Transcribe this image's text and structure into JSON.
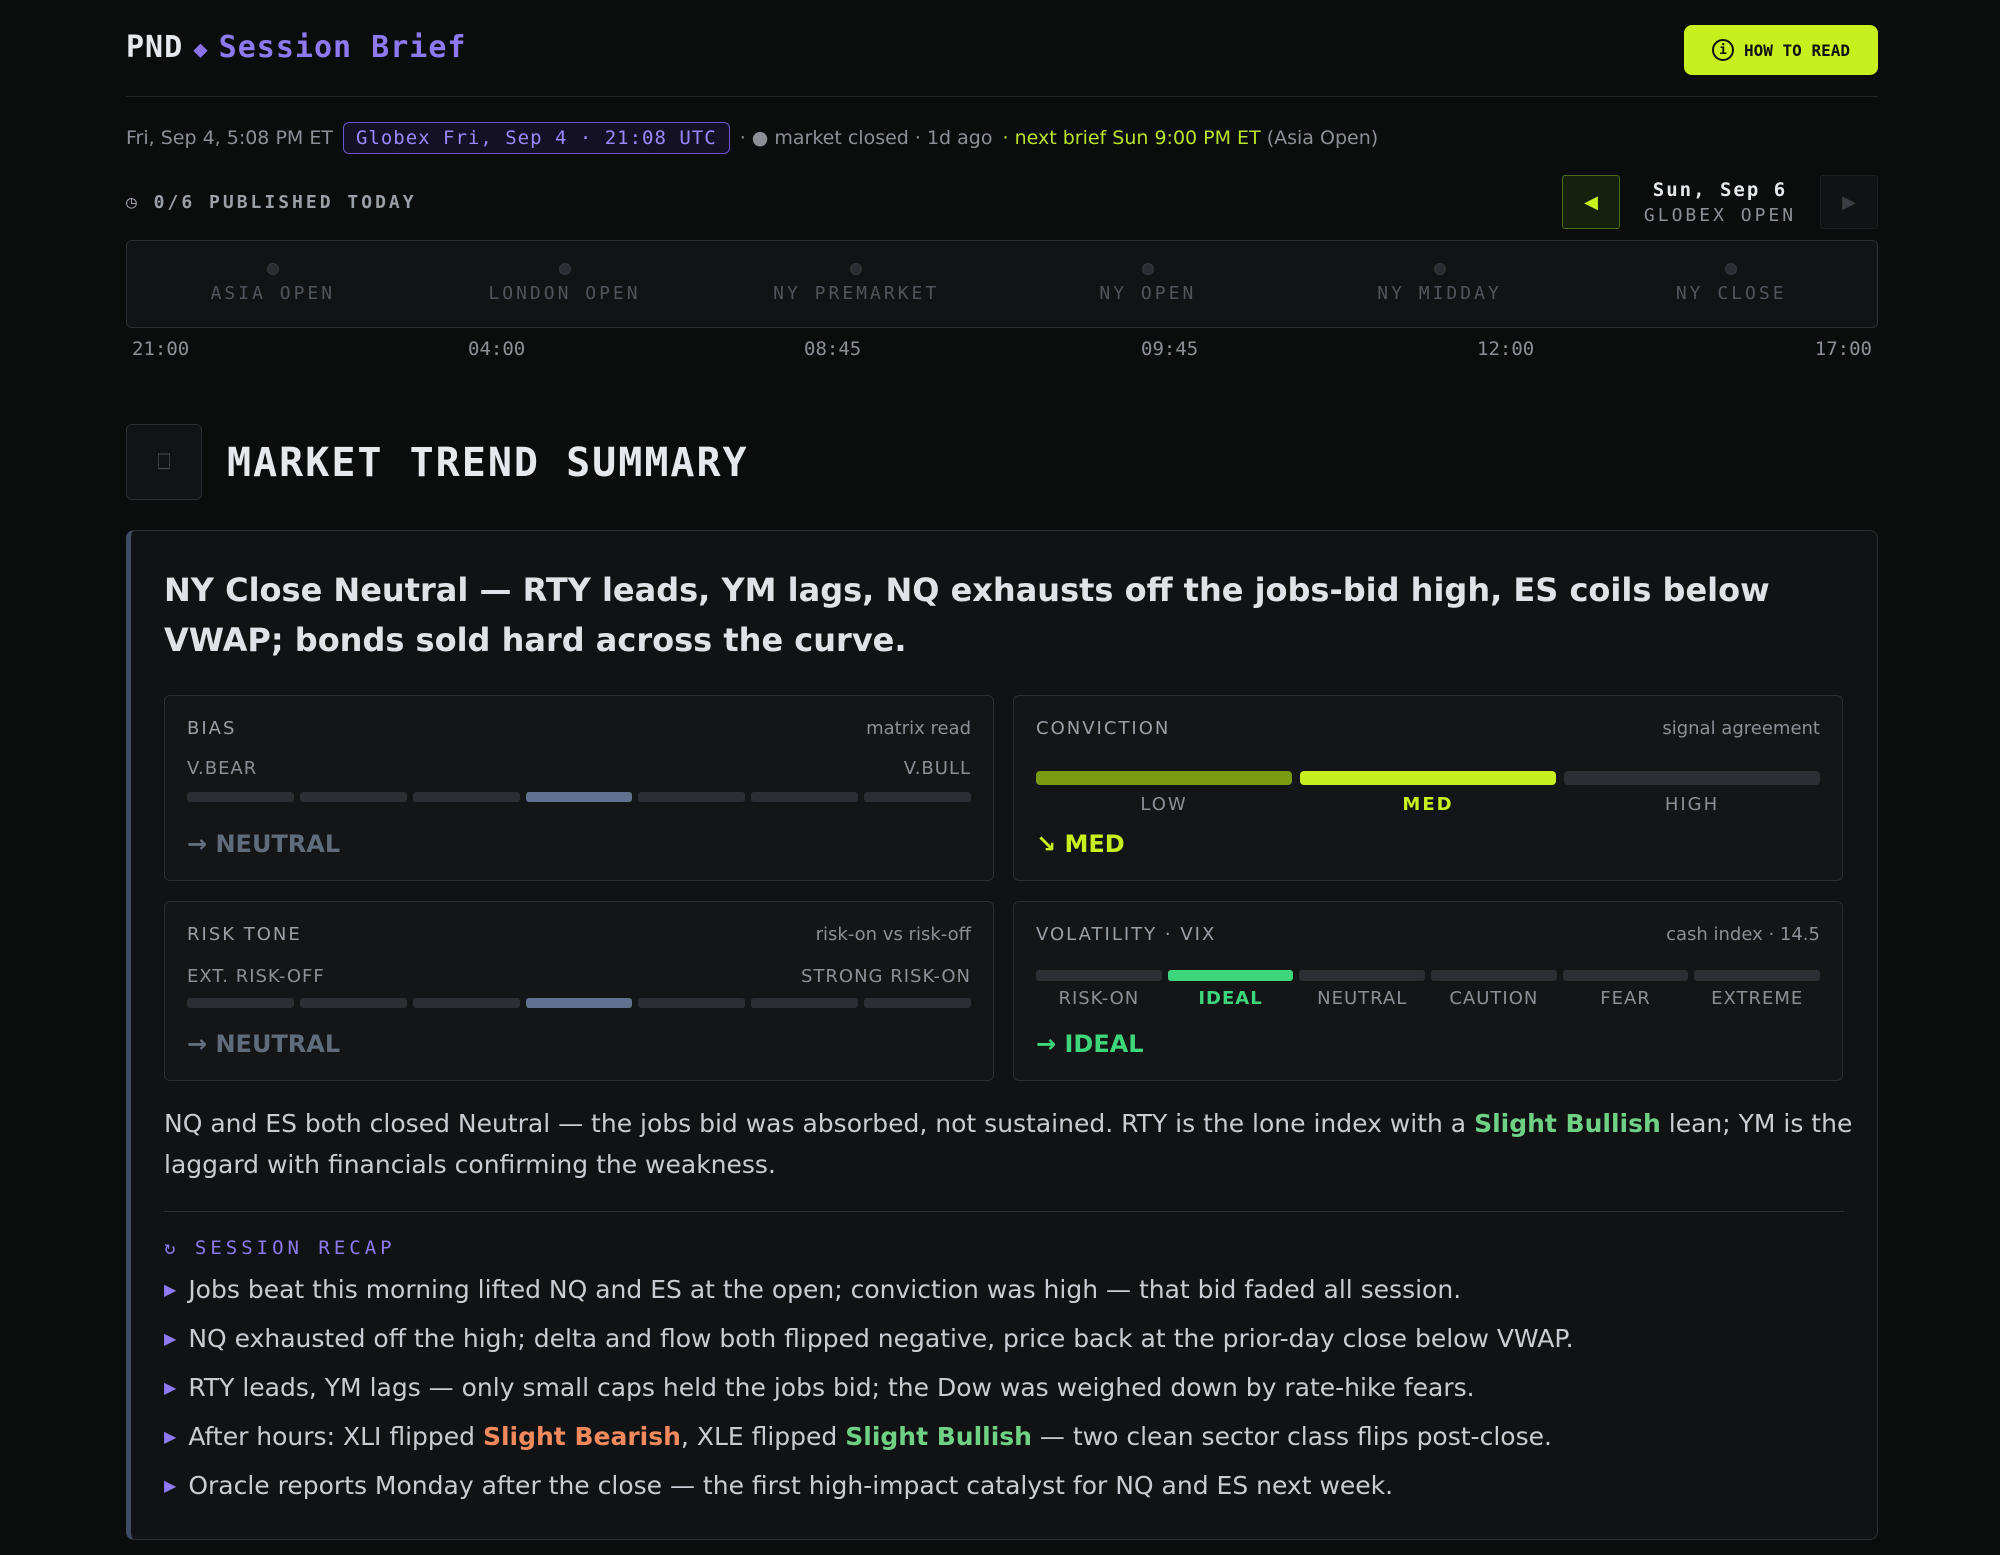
{
  "header": {
    "brand": "PND",
    "separator": "◆",
    "title": "Session Brief",
    "how_to_read": "HOW TO READ"
  },
  "meta": {
    "local_time": "Fri, Sep 4, 5:08 PM ET",
    "globex_pill": "Globex Fri, Sep 4 · 21:08 UTC",
    "status": "· ● market closed · 1d ago",
    "next_brief": "· next brief Sun 9:00 PM ET",
    "next_brief_session": "(Asia Open)"
  },
  "published": "◷ 0/6 PUBLISHED TODAY",
  "nav": {
    "prev": "◀",
    "next": "▶",
    "date": "Sun, Sep 6",
    "session": "GLOBEX OPEN"
  },
  "timeline": {
    "sessions": [
      "ASIA OPEN",
      "LONDON OPEN",
      "NY PREMARKET",
      "NY OPEN",
      "NY MIDDAY",
      "NY CLOSE"
    ],
    "times": [
      "21:00",
      "04:00",
      "08:45",
      "09:45",
      "12:00",
      "17:00"
    ]
  },
  "section": {
    "icon": "⎕",
    "title": "MARKET TREND SUMMARY"
  },
  "card": {
    "headline": "NY Close Neutral — RTY leads, YM lags, NQ exhausts off the jobs-bid high, ES coils below VWAP; bonds sold hard across the curve.",
    "bias": {
      "label": "BIAS",
      "note": "matrix read",
      "left": "V.BEAR",
      "right": "V.BULL",
      "segments": 7,
      "active_index": 3,
      "arrow": "→",
      "value": "NEUTRAL"
    },
    "conviction": {
      "label": "CONVICTION",
      "note": "signal agreement",
      "levels": [
        "LOW",
        "MED",
        "HIGH"
      ],
      "active_index": 1,
      "arrow": "↘",
      "value": "MED"
    },
    "risk": {
      "label": "RISK TONE",
      "note": "risk-on vs risk-off",
      "left": "EXT. RISK-OFF",
      "right": "STRONG RISK-ON",
      "segments": 7,
      "active_index": 3,
      "arrow": "→",
      "value": "NEUTRAL"
    },
    "vix": {
      "label": "VOLATILITY · VIX",
      "note": "cash index · 14.5",
      "levels": [
        "RISK-ON",
        "IDEAL",
        "NEUTRAL",
        "CAUTION",
        "FEAR",
        "EXTREME"
      ],
      "active_index": 1,
      "arrow": "→",
      "value": "IDEAL"
    },
    "paragraph": {
      "a": "NQ and ES both closed Neutral — the jobs bid was absorbed, not sustained. RTY is the lone index with a ",
      "hl": "Slight Bullish",
      "b": " lean; YM is the laggard with financials confirming the weakness."
    },
    "recap_title": "↻ SESSION RECAP",
    "bullet_marker": "▶",
    "bullets": [
      "Jobs beat this morning lifted NQ and ES at the open; conviction was high — that bid faded all session.",
      "NQ exhausted off the high; delta and flow both flipped negative, price back at the prior-day close below VWAP.",
      "RTY leads, YM lags — only small caps held the jobs bid; the Dow was weighed down by rate-hike fears."
    ],
    "bullet4": {
      "a": "After hours: XLI flipped ",
      "hl1": "Slight Bearish",
      "b": ", XLE flipped ",
      "hl2": "Slight Bullish",
      "c": " — two clean sector class flips post-close."
    },
    "bullet5": "Oracle reports Monday after the close — the first high-impact catalyst for NQ and ES next week."
  },
  "colors": {
    "accent_lime": "#c8f01e",
    "accent_violet": "#8f79f0",
    "bullish_green": "#6fd184",
    "bearish_orange": "#f08a5d",
    "neutral_slate": "#5f7390"
  },
  "icons": [
    "info-icon",
    "clock-icon",
    "chevron-left-icon",
    "chevron-right-icon",
    "section-icon",
    "recap-icon",
    "bullet-triangle-icon"
  ]
}
